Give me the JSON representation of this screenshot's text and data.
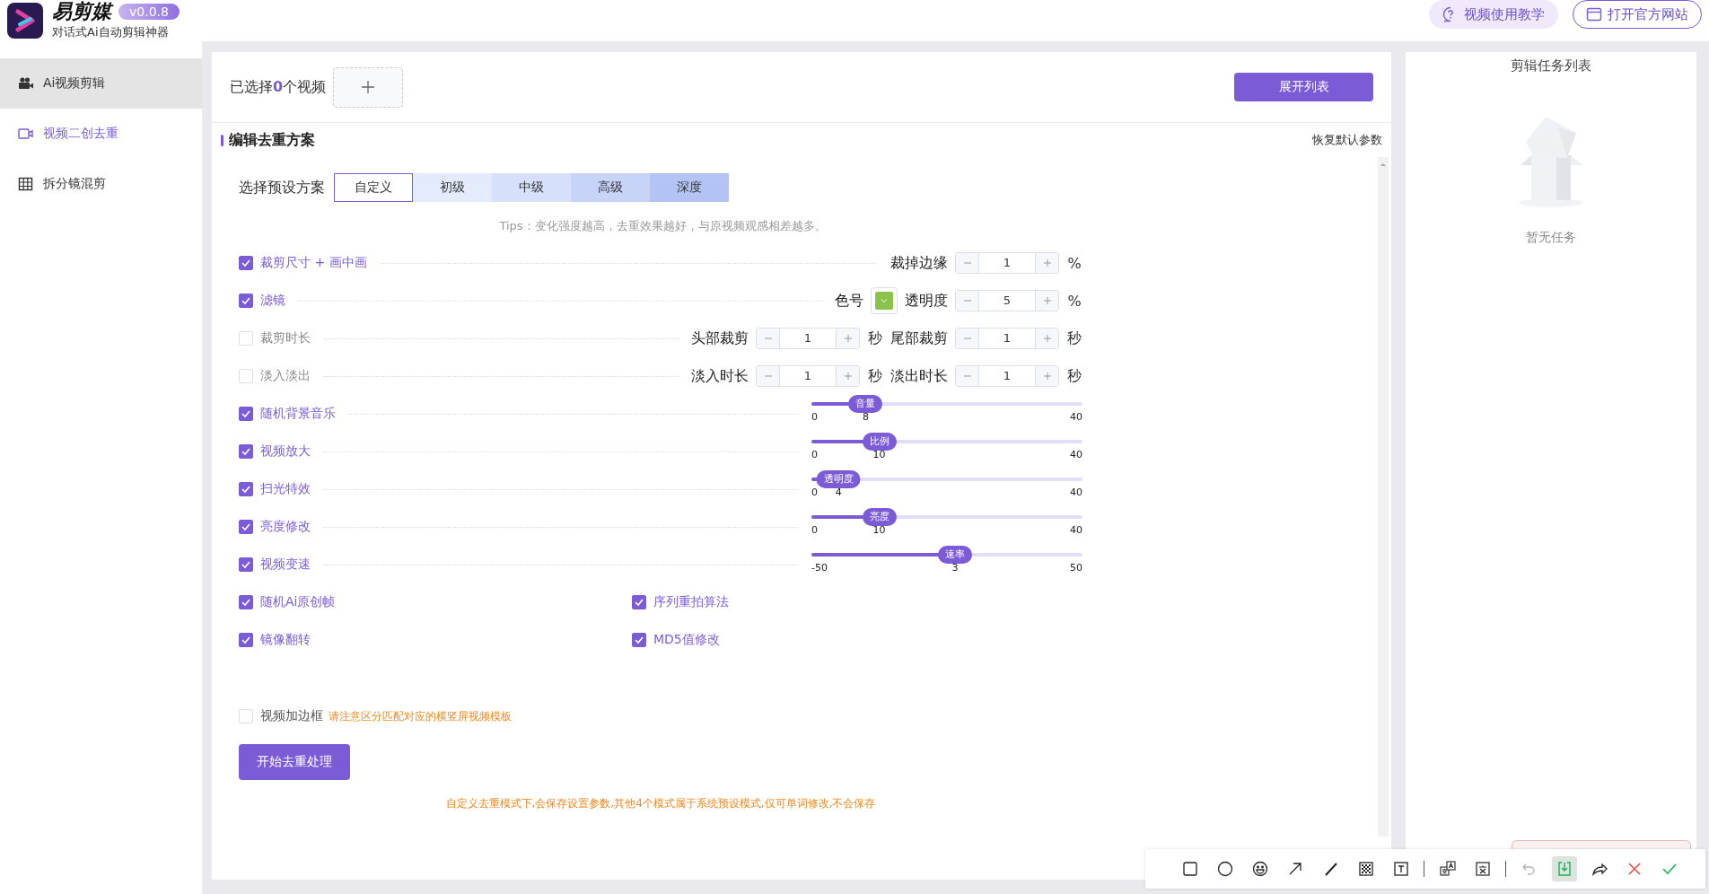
{
  "app": {
    "name": "易剪媒",
    "version": "v0.0.8",
    "tagline": "对话式Ai自动剪辑神器"
  },
  "header_buttons": [
    {
      "label": "视频使用教学",
      "kind": "filled"
    },
    {
      "label": "打开官方网站",
      "kind": "outlined"
    }
  ],
  "sidebar": {
    "items": [
      {
        "label": "Ai视频剪辑",
        "kind": "camera",
        "selected": false,
        "hovered": true
      },
      {
        "label": "视频二创去重",
        "kind": "video",
        "selected": true,
        "hovered": false
      },
      {
        "label": "拆分镜混剪",
        "kind": "grid",
        "selected": false,
        "hovered": false
      }
    ]
  },
  "selection": {
    "text": "已选择**0**个视频",
    "expand_button": "展开列表"
  },
  "section": {
    "title": "编辑去重方案",
    "reset": "恢复默认参数"
  },
  "presets": {
    "label": "选择预设方案",
    "tabs": [
      {
        "label": "自定义",
        "selected": true
      },
      {
        "label": "初级",
        "selected": false
      },
      {
        "label": "中级",
        "selected": false
      },
      {
        "label": "高级",
        "selected": false
      },
      {
        "label": "深度",
        "selected": false
      }
    ]
  },
  "tips": "Tips：变化强度越高，去重效果越好，与原视频观感相差越多。",
  "options": [
    {
      "kind": "params",
      "label": "裁剪尺寸 + 画中画",
      "checked": true,
      "controls": [
        {
          "kind": "stepper",
          "label": "裁掉边缘",
          "value": "1",
          "unit": "%"
        }
      ]
    },
    {
      "kind": "params",
      "label": "滤镜",
      "checked": true,
      "controls": [
        {
          "kind": "color",
          "label": "色号",
          "color": "#8bc34a"
        },
        {
          "kind": "stepper",
          "label": "透明度",
          "value": "5",
          "unit": "%"
        }
      ]
    },
    {
      "kind": "params",
      "label": "裁剪时长",
      "checked": false,
      "controls": [
        {
          "kind": "stepper",
          "label": "头部裁剪",
          "value": "1",
          "unit": "秒"
        },
        {
          "kind": "stepper",
          "label": "尾部裁剪",
          "value": "1",
          "unit": "秒"
        }
      ]
    },
    {
      "kind": "params",
      "label": "淡入淡出",
      "checked": false,
      "controls": [
        {
          "kind": "stepper",
          "label": "淡入时长",
          "value": "1",
          "unit": "秒"
        },
        {
          "kind": "stepper",
          "label": "淡出时长",
          "value": "1",
          "unit": "秒"
        }
      ]
    },
    {
      "kind": "slider",
      "label": "随机背景音乐",
      "checked": true,
      "slider": {
        "name": "音量",
        "level": 0.2,
        "min": "0",
        "value": "8",
        "max": "40"
      }
    },
    {
      "kind": "slider",
      "label": "视频放大",
      "checked": true,
      "slider": {
        "name": "比例",
        "level": 0.25,
        "min": "0",
        "value": "10",
        "max": "40"
      }
    },
    {
      "kind": "slider",
      "label": "扫光特效",
      "checked": true,
      "slider": {
        "name": "透明度",
        "level": 0.1,
        "min": "0",
        "value": "4",
        "max": "40"
      }
    },
    {
      "kind": "slider",
      "label": "亮度修改",
      "checked": true,
      "slider": {
        "name": "亮度",
        "level": 0.25,
        "min": "0",
        "value": "10",
        "max": "40"
      }
    },
    {
      "kind": "slider",
      "label": "视频变速",
      "checked": true,
      "slider": {
        "name": "速率",
        "level": 0.53,
        "min": "-50",
        "value": "3",
        "max": "50"
      }
    },
    {
      "kind": "pair",
      "items": [
        {
          "label": "随机Ai原创帧",
          "checked": true
        },
        {
          "label": "序列重拍算法",
          "checked": true
        }
      ]
    },
    {
      "kind": "pair",
      "items": [
        {
          "label": "镜像翻转",
          "checked": true
        },
        {
          "label": "MD5值修改",
          "checked": true
        }
      ]
    }
  ],
  "border_option": {
    "label": "视频加边框",
    "checked": false,
    "note": "请注意区分匹配对应的横竖屏视频模板"
  },
  "start_button": "开始去重处理",
  "footer_note": "自定义去重模式下,会保存设置参数,其他4个模式属于系统预设模式,仅可单词修改,不会保存",
  "task_panel": {
    "title": "剪辑任务列表",
    "empty": "暂无任务"
  },
  "screenshot_toolbar": {
    "groups": [
      [
        {
          "kind": "rect",
          "disabled": false,
          "selected": false
        },
        {
          "kind": "circle",
          "disabled": false,
          "selected": false
        },
        {
          "kind": "emoji",
          "disabled": false,
          "selected": false
        },
        {
          "kind": "arrow",
          "disabled": false,
          "selected": false
        },
        {
          "kind": "pen",
          "disabled": false,
          "selected": false
        },
        {
          "kind": "mosaic",
          "disabled": false,
          "selected": false
        },
        {
          "kind": "text",
          "disabled": false,
          "selected": false
        }
      ],
      [
        {
          "kind": "translate",
          "disabled": false,
          "selected": false
        },
        {
          "kind": "ocr",
          "disabled": false,
          "selected": false
        }
      ],
      [
        {
          "kind": "undo",
          "disabled": true,
          "selected": false
        },
        {
          "kind": "save",
          "disabled": false,
          "selected": true
        },
        {
          "kind": "share",
          "disabled": false,
          "selected": false
        },
        {
          "kind": "cancel",
          "disabled": false,
          "selected": false
        },
        {
          "kind": "confirm",
          "disabled": false,
          "selected": false
        }
      ]
    ]
  }
}
